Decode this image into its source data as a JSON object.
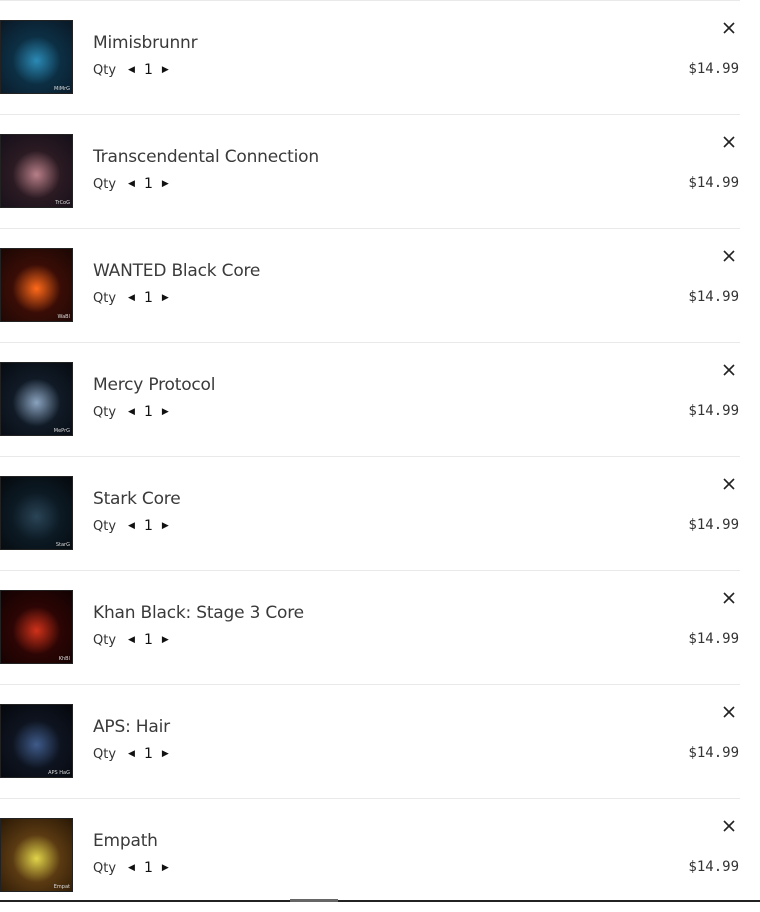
{
  "cart": {
    "items": [
      {
        "title": "Mimisbrunnr",
        "qty_label": "Qty",
        "qty": "1",
        "price": "$14.99",
        "thumb_tag": "MiMrG",
        "thumb_colors": [
          "#0c2f44",
          "#2b8ab5",
          "#0a1826"
        ]
      },
      {
        "title": "Transcendental Connection",
        "qty_label": "Qty",
        "qty": "1",
        "price": "$14.99",
        "thumb_tag": "TrCoG",
        "thumb_colors": [
          "#2b1a22",
          "#b87f88",
          "#15101a"
        ]
      },
      {
        "title": "WANTED Black Core",
        "qty_label": "Qty",
        "qty": "1",
        "price": "$14.99",
        "thumb_tag": "WaBl",
        "thumb_colors": [
          "#3a0d06",
          "#ff6a1a",
          "#1a0704"
        ]
      },
      {
        "title": "Mercy Protocol",
        "qty_label": "Qty",
        "qty": "1",
        "price": "$14.99",
        "thumb_tag": "MePrG",
        "thumb_colors": [
          "#101a26",
          "#8aa3bf",
          "#070b11"
        ]
      },
      {
        "title": "Stark Core",
        "qty_label": "Qty",
        "qty": "1",
        "price": "$14.99",
        "thumb_tag": "StarG",
        "thumb_colors": [
          "#0c1a24",
          "#2a4456",
          "#05090d"
        ]
      },
      {
        "title": "Khan Black: Stage 3 Core",
        "qty_label": "Qty",
        "qty": "1",
        "price": "$14.99",
        "thumb_tag": "KhBl",
        "thumb_colors": [
          "#2c0504",
          "#d0321a",
          "#120202"
        ]
      },
      {
        "title": "APS: Hair",
        "qty_label": "Qty",
        "qty": "1",
        "price": "$14.99",
        "thumb_tag": "APS HaG",
        "thumb_colors": [
          "#0e1420",
          "#3f5b8a",
          "#05070c"
        ]
      },
      {
        "title": "Empath",
        "qty_label": "Qty",
        "qty": "1",
        "price": "$14.99",
        "thumb_tag": "Empat",
        "thumb_colors": [
          "#5a3a12",
          "#e1d44a",
          "#2a1805"
        ]
      }
    ]
  },
  "icons": {
    "remove": "close-icon",
    "decrease": "triangle-left-icon",
    "increase": "triangle-right-icon"
  }
}
